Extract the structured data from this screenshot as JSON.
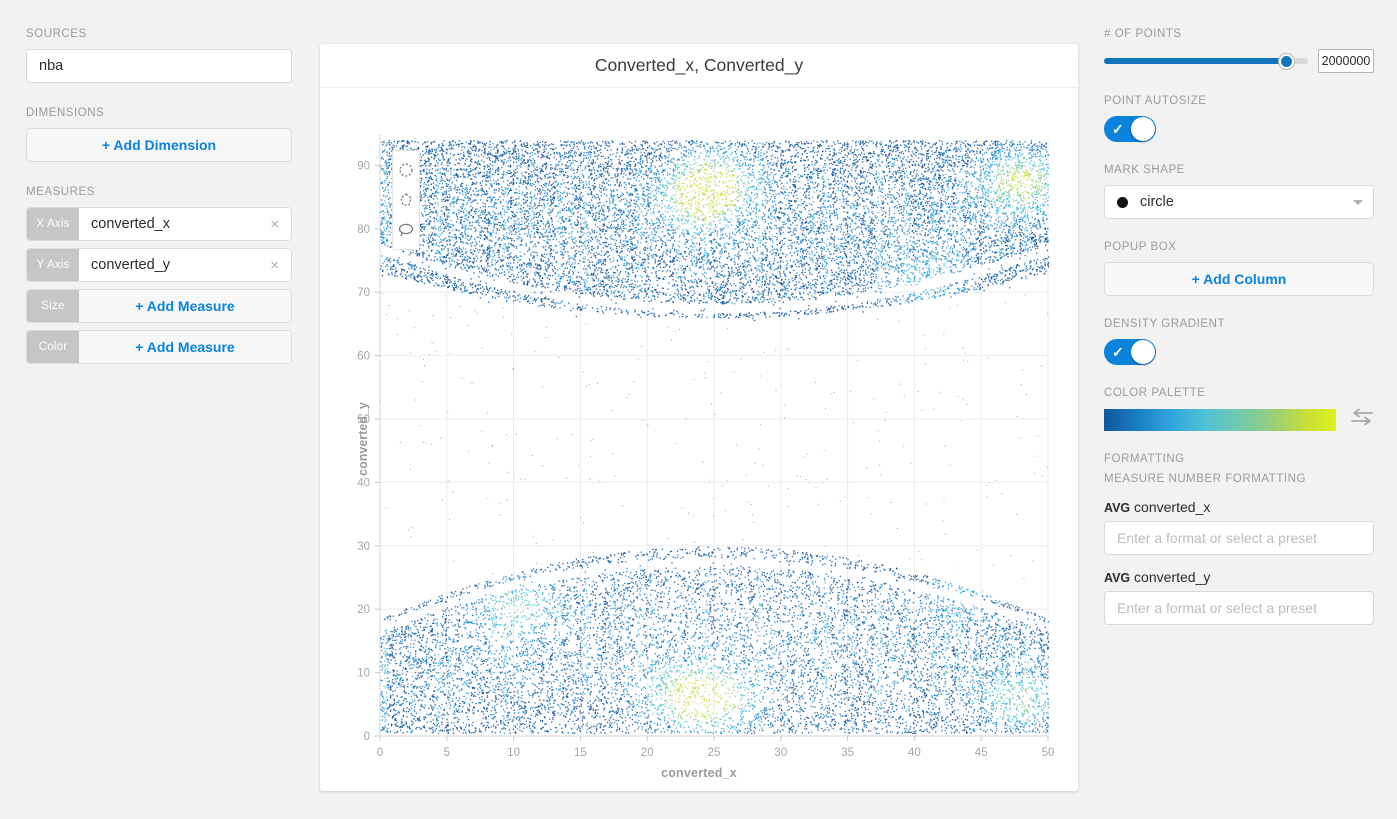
{
  "left": {
    "sources_label": "SOURCES",
    "source_value": "nba",
    "dimensions_label": "DIMENSIONS",
    "add_dimension_label": "+ Add Dimension",
    "measures_label": "MEASURES",
    "measures": [
      {
        "chip": "X Axis",
        "value": "converted_x",
        "clear": "×",
        "has_value": true
      },
      {
        "chip": "Y Axis",
        "value": "converted_y",
        "clear": "×",
        "has_value": true
      },
      {
        "chip": "Size",
        "value": "+ Add Measure",
        "has_value": false
      },
      {
        "chip": "Color",
        "value": "+ Add Measure",
        "has_value": false
      }
    ]
  },
  "chart": {
    "title": "Converted_x,  Converted_y",
    "tools": [
      "circle-select-icon",
      "polygon-select-icon",
      "lasso-select-icon"
    ]
  },
  "chart_data": {
    "type": "scatter",
    "title": "Converted_x,  Converted_y",
    "xlabel": "converted_x",
    "ylabel": "converted_y",
    "xlim": [
      0,
      50
    ],
    "ylim": [
      0,
      94
    ],
    "xticks": [
      0,
      5,
      10,
      15,
      20,
      25,
      30,
      35,
      40,
      45,
      50
    ],
    "yticks": [
      0,
      10,
      20,
      30,
      40,
      50,
      60,
      70,
      80,
      90
    ],
    "grid": true,
    "legend": "none",
    "point_count": 2000000,
    "mark_shape": "circle",
    "density_gradient": true,
    "colormap": [
      "#10559a",
      "#1b7ec4",
      "#2fa5dc",
      "#4fc0d6",
      "#6fc9b0",
      "#93cf7e",
      "#c2dd3e",
      "#dff21a"
    ],
    "density_hotspots": [
      {
        "x": 25,
        "y": 88,
        "level": "high"
      },
      {
        "x": 24,
        "y": 85,
        "level": "high"
      },
      {
        "x": 48,
        "y": 88,
        "level": "high"
      },
      {
        "x": 25,
        "y": 5,
        "level": "high"
      },
      {
        "x": 23,
        "y": 6,
        "level": "high"
      },
      {
        "x": 48,
        "y": 5,
        "level": "medium"
      },
      {
        "x": 41,
        "y": 71,
        "level": "medium"
      },
      {
        "x": 10,
        "y": 21,
        "level": "medium"
      },
      {
        "x": 44,
        "y": 24,
        "level": "medium"
      }
    ],
    "description": "Dense two-lobe scatter of 2,000,000 points with vertical striping; an upper lobe above y≈66 and a lower lobe below y≈30, separated by a sparse band, with arc-shaped white gaps."
  },
  "right": {
    "points_label": "# OF POINTS",
    "points_value": "2000000",
    "points_fill_pct": 91,
    "autosize_label": "POINT AUTOSIZE",
    "autosize_on": true,
    "mark_shape_label": "MARK SHAPE",
    "mark_shape_value": "circle",
    "popup_box_label": "POPUP BOX",
    "add_column_label": "+ Add Column",
    "density_label": "DENSITY GRADIENT",
    "density_on": true,
    "palette_label": "COLOR PALETTE",
    "swap_icon": "swap-arrows-icon",
    "formatting_label": "FORMATTING",
    "measure_formatting_label": "MEASURE NUMBER FORMATTING",
    "format_rows": [
      {
        "agg": "AVG",
        "field": " converted_x",
        "placeholder": "Enter a format or select a preset"
      },
      {
        "agg": "AVG",
        "field": " converted_y",
        "placeholder": "Enter a format or select a preset"
      }
    ]
  },
  "colors": {
    "accent": "#0b82dc",
    "slider": "#1274bd",
    "chip": "#c6c6c6",
    "bg": "#f2f2f2"
  }
}
